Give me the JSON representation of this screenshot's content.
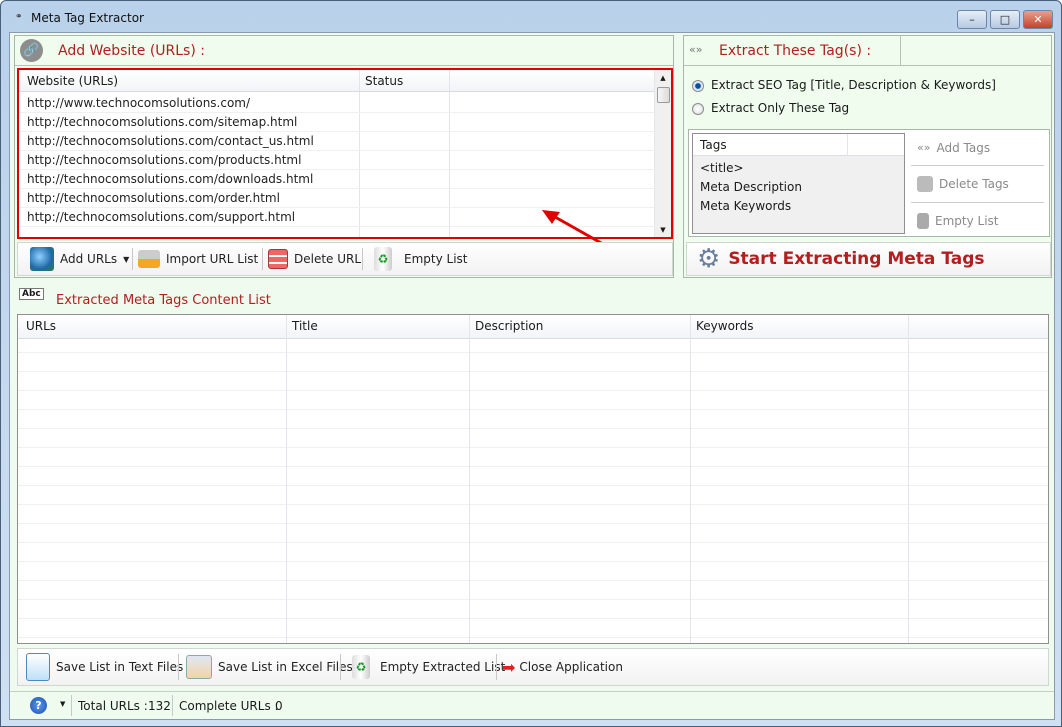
{
  "window": {
    "title": "Meta Tag Extractor",
    "minimize": "–",
    "maximize": "□",
    "close": "✕"
  },
  "add_website": {
    "title": "Add Website (URLs) :",
    "icon": "link-icon",
    "columns": [
      "Website (URLs)",
      "Status"
    ],
    "rows": [
      "http://www.technocomsolutions.com/",
      "http://technocomsolutions.com/sitemap.html",
      "http://technocomsolutions.com/contact_us.html",
      "http://technocomsolutions.com/products.html",
      "http://technocomsolutions.com/downloads.html",
      "http://technocomsolutions.com/order.html",
      "http://technocomsolutions.com/support.html"
    ],
    "toolbar": {
      "add_urls": "Add URLs",
      "import": "Import URL List",
      "delete": "Delete URL",
      "empty": "Empty List"
    }
  },
  "extract_tags": {
    "title": "Extract These Tag(s) :",
    "options": [
      {
        "label": "Extract SEO Tag [Title, Description & Keywords]",
        "selected": true
      },
      {
        "label": "Extract Only These Tag",
        "selected": false
      }
    ],
    "tags_header": "Tags",
    "tags": [
      "<title>",
      "Meta Description",
      "Meta Keywords"
    ],
    "add_tags": "Add Tags",
    "delete_tags": "Delete Tags",
    "empty_list": "Empty List",
    "start": "Start Extracting Meta Tags"
  },
  "extracted": {
    "title": "Extracted Meta Tags Content List",
    "columns": [
      "URLs",
      "Title",
      "Description",
      "Keywords"
    ],
    "toolbar": {
      "save_text": "Save List in Text Files",
      "save_excel": "Save List in Excel Files",
      "empty": "Empty Extracted List",
      "close": "Close Application"
    }
  },
  "status": {
    "total_label": "Total URLs :",
    "total": "132",
    "complete_label": "Complete URLs :",
    "complete": "0"
  },
  "colors": {
    "accent": "#b11f1f",
    "highlight": "#e00000",
    "background": "#effcee"
  }
}
